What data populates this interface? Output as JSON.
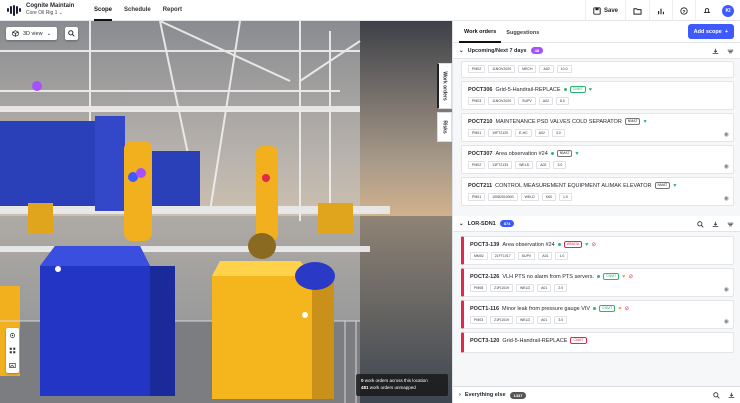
{
  "app": {
    "name": "Cognite Maintain",
    "site": "Core Oil Rig 1"
  },
  "nav": [
    "Scope",
    "Schedule",
    "Report"
  ],
  "top_actions": {
    "save": "Save",
    "avatar": "KI"
  },
  "viewport": {
    "view_mode": "3D view",
    "unmapped_line1_count": "0",
    "unmapped_line1_text": " work orders across this location",
    "unmapped_line2_count": "481",
    "unmapped_line2_text": " work orders unmapped"
  },
  "side_tabs": [
    "Work orders",
    "Risks"
  ],
  "panel": {
    "tabs": [
      "Work orders",
      "Suggestions"
    ],
    "add_scope": "Add scope",
    "group1": {
      "title": "Upcoming/Next 7 days",
      "count": "48",
      "cards": [
        {
          "id": "",
          "title": "",
          "meta": [
            "PM02",
            "11NOV2020",
            "MECH",
            "A02",
            "10.0"
          ]
        },
        {
          "id": "POCT306",
          "title": "Grid-5-Handrail-REPLACE",
          "tag": "CNMT",
          "meta": [
            "PM03",
            "11NOV2020",
            "SUPV",
            "A02",
            "8.0"
          ]
        },
        {
          "id": "POCT210",
          "title": "MAINTENANCE PSD VALVES COLD SEPARATOR",
          "tag": "NMAT",
          "meta": [
            "PM01",
            "19FT2120",
            "E-HC",
            "A02",
            "3.0"
          ]
        },
        {
          "id": "POCT307",
          "title": "Area observation #24",
          "tag": "NMAT",
          "meta": [
            "PM02",
            "13FT2133",
            "WELD",
            "A02",
            "3.0"
          ]
        },
        {
          "id": "POCT211",
          "title": "CONTROL MEASUREMENT EQUIPMENT ALIMAK ELEVATOR",
          "tag": "NMAT",
          "meta": [
            "PM01",
            "10082010000",
            "WELD",
            "K60",
            "1.0"
          ]
        }
      ]
    },
    "group2": {
      "title": "LOR-SDN1",
      "count": "874",
      "cards": [
        {
          "id": "POCT3-139",
          "title": "Area observation #24",
          "tag": "WMATA",
          "meta": [
            "MM02",
            "21FT1017",
            "SUPV",
            "A01",
            "1.0"
          ]
        },
        {
          "id": "POCT2-126",
          "title": "VLH PTS no alarm from PTS servers.",
          "tag": "CNMT",
          "meta": [
            "PM08",
            "21FI1019",
            "WELD",
            "A01",
            "2.0"
          ]
        },
        {
          "id": "POCT1-116",
          "title": "Minor leak from pressure gauge VIV",
          "tag": "CNMT",
          "meta": [
            "PM03",
            "21FI1019",
            "WELD",
            "A01",
            "3.0"
          ]
        },
        {
          "id": "POCT3-120",
          "title": "Grid-5-Handrail-REPLACE",
          "tag": "CNMT",
          "meta": []
        }
      ]
    },
    "group3": {
      "title": "Everything else",
      "count": "1337"
    }
  },
  "colors": {
    "accent": "#3d5afe",
    "purple_badge": "#a452ff",
    "overdue": "#e12a4b",
    "ok": "#2bb673"
  }
}
